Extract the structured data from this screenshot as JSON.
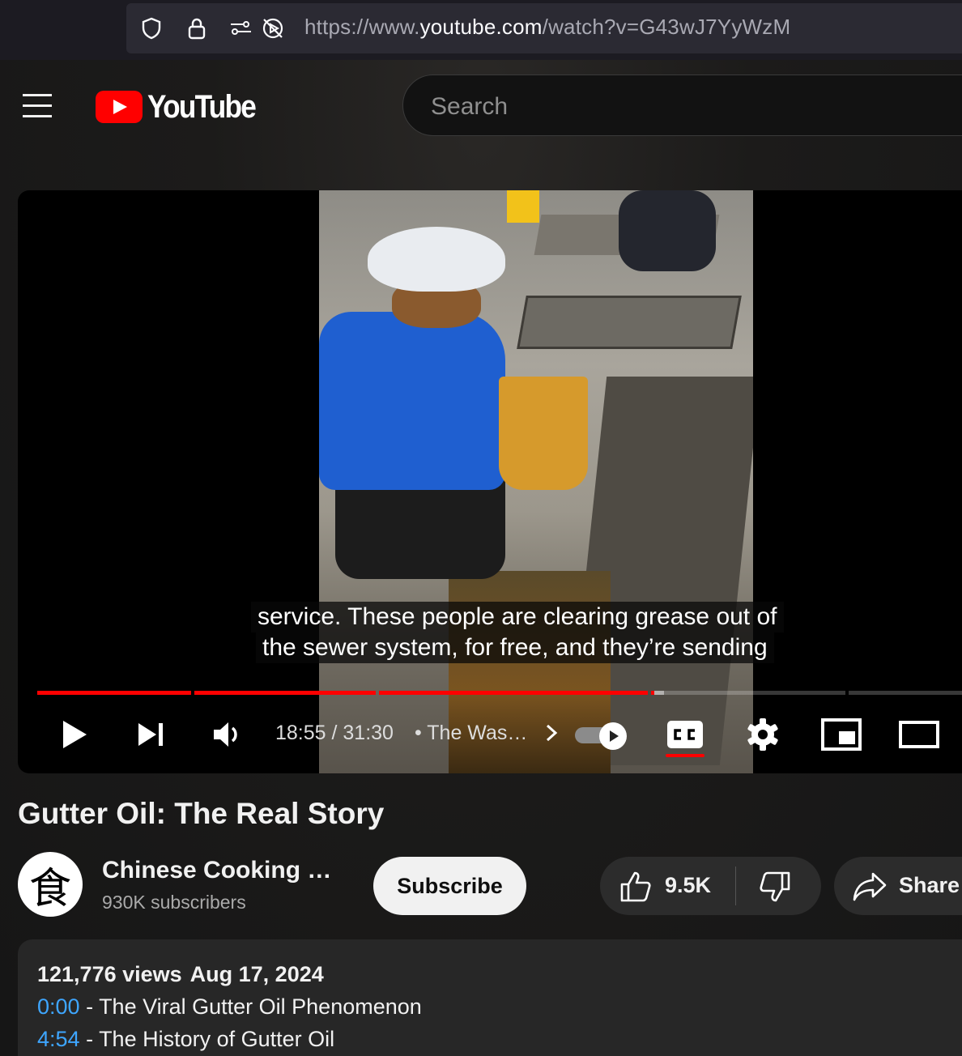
{
  "browser": {
    "url_prefix": "https://www.",
    "url_host": "youtube.com",
    "url_path": "/watch?v=G43wJ7YyWzM"
  },
  "header": {
    "logo_text": "YouTube",
    "search_placeholder": "Search"
  },
  "player": {
    "captions": [
      "service. These people are clearing grease out of",
      "the sewer system, for free, and they’re sending"
    ],
    "time": "18:55 / 31:30",
    "chapter_separator": "•",
    "chapter_title": "The Was…",
    "progress_fraction": 0.601,
    "captions_on": true,
    "autoplay_on": true
  },
  "video": {
    "title": "Gutter Oil: The Real Story",
    "channel_avatar_glyph": "食",
    "channel_name": "Chinese Cooking …",
    "subscribers": "930K subscribers",
    "subscribe_label": "Subscribe",
    "likes": "9.5K",
    "share_label": "Share"
  },
  "description": {
    "views": "121,776 views",
    "date": "Aug 17, 2024",
    "chapters": [
      {
        "time": "0:00",
        "title": " - The Viral Gutter Oil Phenomenon"
      },
      {
        "time": "4:54",
        "title": " - The History of Gutter Oil"
      }
    ]
  },
  "colors": {
    "accent": "#ff0000",
    "link": "#3ea6ff",
    "background": "#0f0f0f"
  }
}
